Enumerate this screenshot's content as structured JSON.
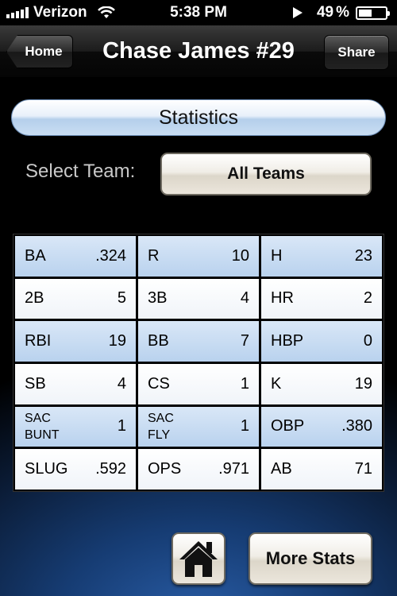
{
  "status_bar": {
    "carrier": "Verizon",
    "time": "5:38 PM",
    "battery_percent": "49",
    "battery_symbol": "%",
    "battery_level": 0.49,
    "signal_bars": 5
  },
  "nav": {
    "back_label": "Home",
    "title": "Chase James #29",
    "share_label": "Share"
  },
  "section_title": "Statistics",
  "team_select": {
    "label": "Select Team:",
    "value": "All Teams"
  },
  "stats": [
    [
      {
        "label": "BA",
        "value": ".324"
      },
      {
        "label": "R",
        "value": "10"
      },
      {
        "label": "H",
        "value": "23"
      }
    ],
    [
      {
        "label": "2B",
        "value": "5"
      },
      {
        "label": "3B",
        "value": "4"
      },
      {
        "label": "HR",
        "value": "2"
      }
    ],
    [
      {
        "label": "RBI",
        "value": "19"
      },
      {
        "label": "BB",
        "value": "7"
      },
      {
        "label": "HBP",
        "value": "0"
      }
    ],
    [
      {
        "label": "SB",
        "value": "4"
      },
      {
        "label": "CS",
        "value": "1"
      },
      {
        "label": "K",
        "value": "19"
      }
    ],
    [
      {
        "label": "SAC\nBUNT",
        "value": "1"
      },
      {
        "label": "SAC\nFLY",
        "value": "1"
      },
      {
        "label": "OBP",
        "value": ".380"
      }
    ],
    [
      {
        "label": "SLUG",
        "value": ".592"
      },
      {
        "label": "OPS",
        "value": ".971"
      },
      {
        "label": "AB",
        "value": "71"
      }
    ]
  ],
  "bottom": {
    "home_icon": "house-icon",
    "more_label": "More Stats"
  },
  "colors": {
    "stat_row_blue": "#c9ddf3",
    "stat_row_white": "#ffffff"
  }
}
